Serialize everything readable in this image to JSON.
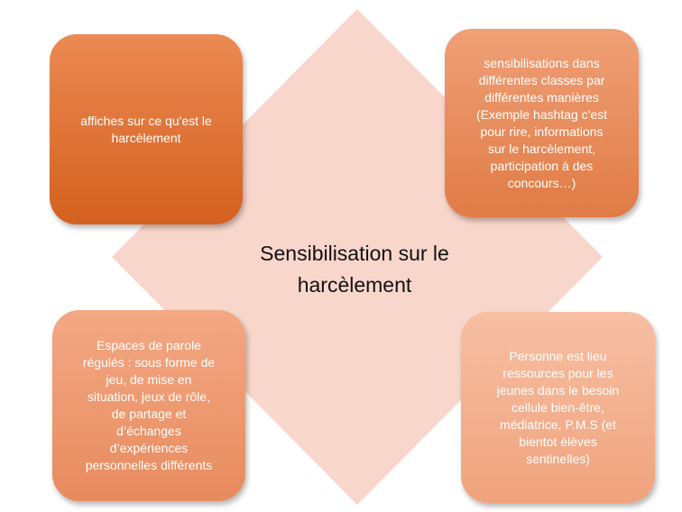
{
  "diagram": {
    "center_title": "Sensibilisation sur le harcèlement",
    "colors": {
      "diamond": "#f8d6cb",
      "top_left": "#d4601e",
      "top_right": "#e07b45",
      "bottom_left": "#e88b5e",
      "bottom_right": "#f0a37d"
    },
    "cards": {
      "top_left": "affiches sur ce qu'est le\nharcèlement",
      "top_right": "sensibilisations dans\ndifférentes classes par\ndifférentes manières\n(Exemple hashtag c'est\npour rire, informations\nsur le harcèlement,\nparticipation à des\nconcours…)",
      "bottom_left": "Espaces de parole\nrégulés : sous forme de\njeu, de mise en\nsituation, jeux de rôle,\nde partage et\nd’échanges\nd’expériences\npersonnelles différents",
      "bottom_right": "Personne est lieu\nressources pour les\njeunes dans le besoin\ncellule bien-être,\nmédiatrice, P.M.S (et\nbientot élèves\nsentinelles)"
    }
  }
}
